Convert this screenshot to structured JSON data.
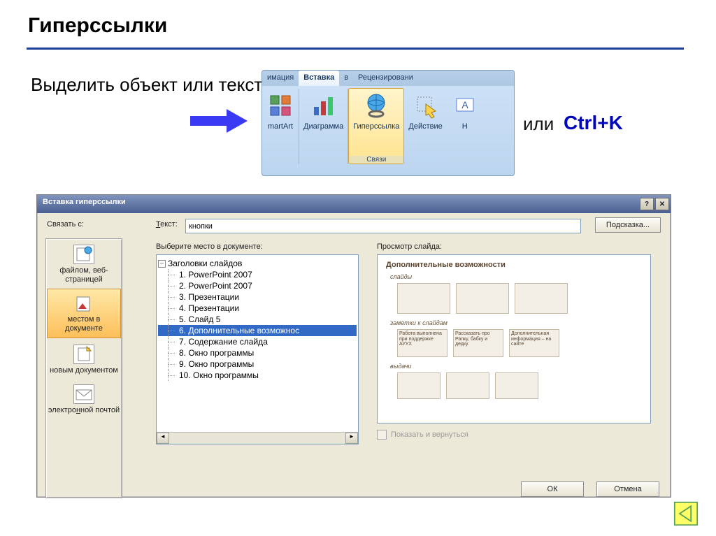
{
  "title": "Гиперссылки",
  "instruction": "Выделить объект или текст",
  "or": "или",
  "shortcut": "Ctrl+K",
  "ribbon": {
    "tabs": {
      "anim": "имация",
      "insert": "Вставка",
      "v": "в",
      "review": "Рецензировани"
    },
    "items": {
      "smartart": "martArt",
      "chart": "Диаграмма",
      "hyperlink": "Гиперссылка",
      "action": "Действие",
      "last": "Н"
    },
    "group": "Связи"
  },
  "dialog": {
    "title": "Вставка гиперссылки",
    "link_with": "Связать с:",
    "text_label": "Текст:",
    "text_value": "кнопки",
    "hint_button": "Подсказка...",
    "select_place": "Выберите место в документе:",
    "preview_label": "Просмотр слайда:",
    "show_return": "Показать и вернуться",
    "ok": "ОК",
    "cancel": "Отмена",
    "side": {
      "file_web": "файлом, веб-страницей",
      "place": "местом в документе",
      "new_doc": "новым документом",
      "email": "электронной почтой"
    },
    "tree": {
      "root": "Заголовки слайдов",
      "items": [
        "1. PowerPoint 2007",
        "2. PowerPoint 2007",
        "3. Презентации",
        "4. Презентации",
        "5. Слайд 5",
        "6. Дополнительные возможнос",
        "7. Содержание слайда",
        "8. Окно программы",
        "9. Окно программы",
        "10. Окно программы"
      ],
      "selected_index": 5
    },
    "preview": {
      "slide_title": "Дополнительные возможности",
      "sec1": "слайды",
      "sec2": "заметки к слайдам",
      "sec3": "выдачи",
      "note1": "Работа выполнена при поддержке АУУХ",
      "note2": "Рассказать про Рапку, бабку и дедку.",
      "note3": "Дополнительная информация – на сайте"
    }
  }
}
